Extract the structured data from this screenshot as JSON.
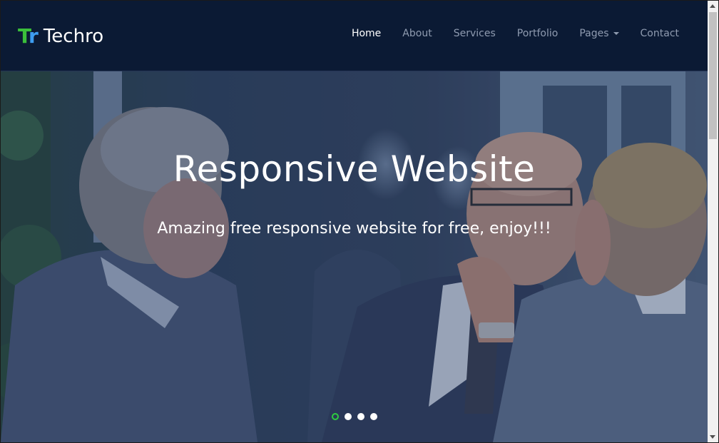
{
  "brand": {
    "logo_t": "T",
    "logo_r": "r",
    "name": "Techro"
  },
  "nav": {
    "items": [
      {
        "label": "Home",
        "active": true
      },
      {
        "label": "About"
      },
      {
        "label": "Services"
      },
      {
        "label": "Portfolio"
      },
      {
        "label": "Pages",
        "dropdown": true
      },
      {
        "label": "Contact"
      }
    ]
  },
  "hero": {
    "title": "Responsive Website",
    "subtitle": "Amazing free responsive website for free, enjoy!!!",
    "slides_total": 4,
    "active_slide": 1
  },
  "colors": {
    "navbar_bg": "#0b1a34",
    "logo_green": "#3bbf3b",
    "logo_blue": "#3d9df0",
    "active_dot": "#2ecc40",
    "nav_text": "#8f9bb0"
  },
  "icons": [
    "caret-down-icon",
    "scroll-up-arrow-icon",
    "scroll-down-arrow-icon"
  ]
}
